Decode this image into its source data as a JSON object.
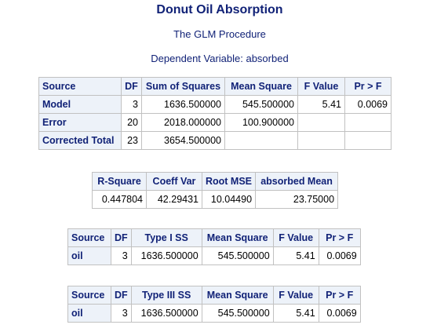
{
  "title": "Donut Oil Absorption",
  "procedure": "The GLM Procedure",
  "dependent_variable": "Dependent Variable: absorbed",
  "anova": {
    "headers": [
      "Source",
      "DF",
      "Sum of Squares",
      "Mean Square",
      "F Value",
      "Pr > F"
    ],
    "rows": [
      {
        "source": "Model",
        "df": "3",
        "ss": "1636.500000",
        "ms": "545.500000",
        "f": "5.41",
        "p": "0.0069"
      },
      {
        "source": "Error",
        "df": "20",
        "ss": "2018.000000",
        "ms": "100.900000",
        "f": "",
        "p": ""
      },
      {
        "source": "Corrected Total",
        "df": "23",
        "ss": "3654.500000",
        "ms": "",
        "f": "",
        "p": ""
      }
    ]
  },
  "fit": {
    "headers": [
      "R-Square",
      "Coeff Var",
      "Root MSE",
      "absorbed Mean"
    ],
    "values": [
      "0.447804",
      "42.29431",
      "10.04490",
      "23.75000"
    ]
  },
  "type1": {
    "headers": [
      "Source",
      "DF",
      "Type I SS",
      "Mean Square",
      "F Value",
      "Pr > F"
    ],
    "row": {
      "source": "oil",
      "df": "3",
      "ss": "1636.500000",
      "ms": "545.500000",
      "f": "5.41",
      "p": "0.0069"
    }
  },
  "type3": {
    "headers": [
      "Source",
      "DF",
      "Type III SS",
      "Mean Square",
      "F Value",
      "Pr > F"
    ],
    "row": {
      "source": "oil",
      "df": "3",
      "ss": "1636.500000",
      "ms": "545.500000",
      "f": "5.41",
      "p": "0.0069"
    }
  },
  "colors": {
    "title_text": "#112277",
    "header_background": "#edf2f9",
    "border": "#c1c1c1"
  }
}
